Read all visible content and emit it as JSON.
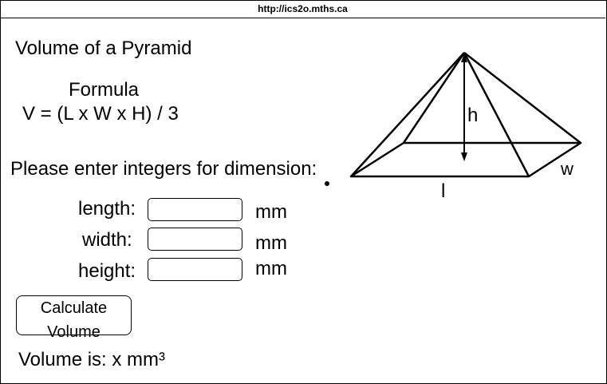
{
  "browser": {
    "url": "http://ics2o.mths.ca"
  },
  "page": {
    "title": "Volume of a Pyramid",
    "formula_heading": "Formula",
    "formula": "V = (L x W x H) / 3",
    "prompt": "Please enter integers for dimension:"
  },
  "form": {
    "length": {
      "label": "length:",
      "value": "",
      "unit": "mm"
    },
    "width": {
      "label": "width:",
      "value": "",
      "unit": "mm"
    },
    "height": {
      "label": "height:",
      "value": "",
      "unit": "mm"
    },
    "calculate_label": "Calculate Volume"
  },
  "result": {
    "text": "Volume is: x mm³"
  },
  "diagram": {
    "height_label": "h",
    "length_label": "l",
    "width_label": "w"
  }
}
